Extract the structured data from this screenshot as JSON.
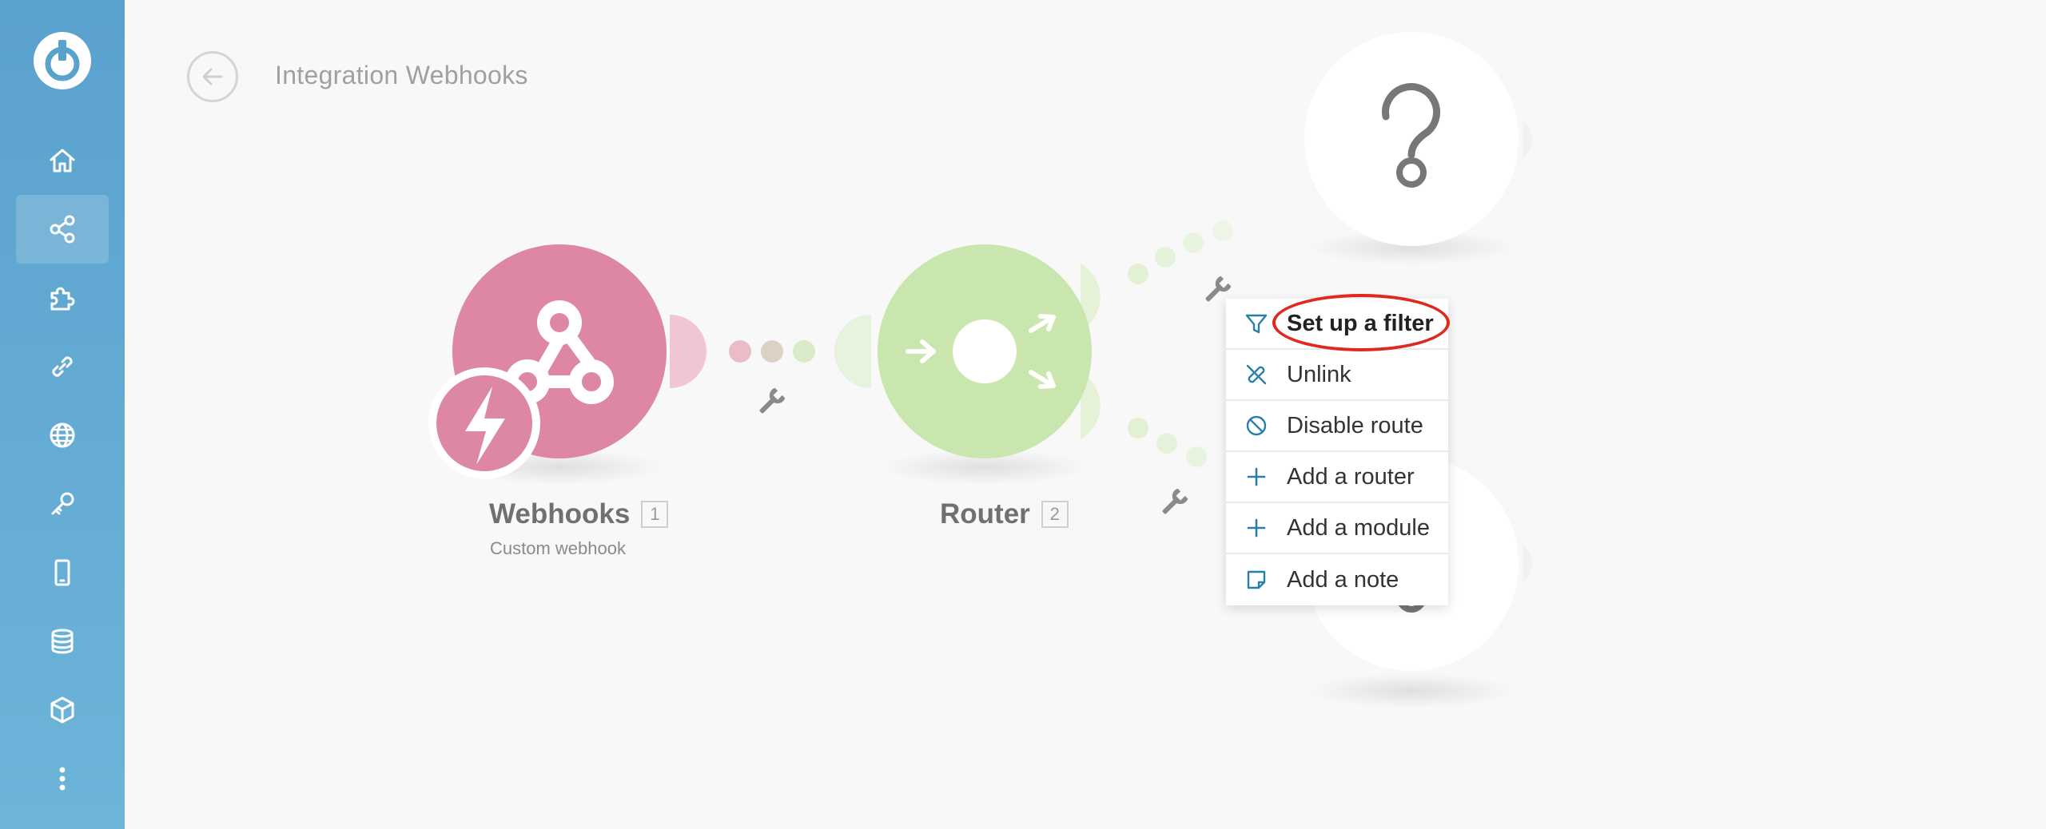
{
  "header": {
    "title": "Integration Webhooks"
  },
  "sidebar": {
    "items": [
      {
        "icon": "home-icon",
        "active": false
      },
      {
        "icon": "scenarios-share-icon",
        "active": true
      },
      {
        "icon": "puzzle-icon",
        "active": false
      },
      {
        "icon": "link-icon",
        "active": false
      },
      {
        "icon": "globe-icon",
        "active": false
      },
      {
        "icon": "key-icon",
        "active": false
      },
      {
        "icon": "mobile-device-icon",
        "active": false
      },
      {
        "icon": "database-icon",
        "active": false
      },
      {
        "icon": "cube-icon",
        "active": false
      },
      {
        "icon": "more-vertical-icon",
        "active": false
      }
    ]
  },
  "modules": [
    {
      "name": "Webhooks",
      "index": "1",
      "subtitle": "Custom webhook",
      "color": "#de87a2"
    },
    {
      "name": "Router",
      "index": "2",
      "subtitle": "",
      "color": "#c8e6ae"
    }
  ],
  "placeholder_icon": "question-mark-icon",
  "context_menu": {
    "items": [
      {
        "label": "Set up a filter",
        "icon": "filter-icon",
        "highlighted": true
      },
      {
        "label": "Unlink",
        "icon": "unlink-icon",
        "highlighted": false
      },
      {
        "label": "Disable route",
        "icon": "disable-icon",
        "highlighted": false
      },
      {
        "label": "Add a router",
        "icon": "plus-icon",
        "highlighted": false
      },
      {
        "label": "Add a module",
        "icon": "plus-icon",
        "highlighted": false
      },
      {
        "label": "Add a note",
        "icon": "note-icon",
        "highlighted": false
      }
    ]
  },
  "colors": {
    "sidebar": "#5aa2ce",
    "webhooks": "#de87a2",
    "router": "#c8e6ae",
    "menu_icon": "#2a7fa6",
    "highlight": "#e0281f"
  }
}
